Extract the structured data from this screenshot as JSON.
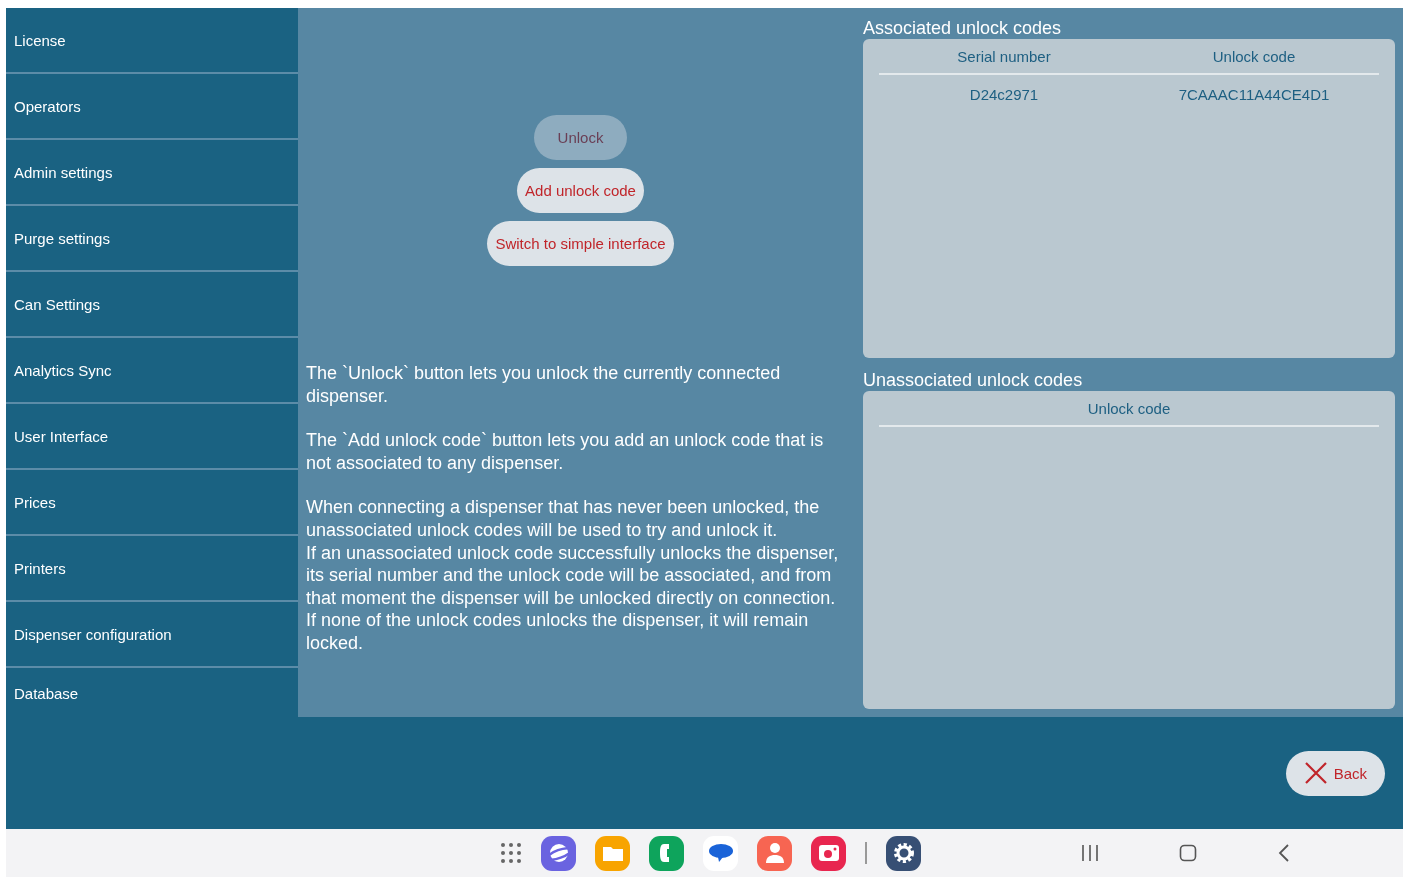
{
  "sidebar": {
    "items": [
      {
        "label": "License"
      },
      {
        "label": "Operators"
      },
      {
        "label": "Admin settings"
      },
      {
        "label": "Purge settings"
      },
      {
        "label": "Can Settings"
      },
      {
        "label": "Analytics Sync"
      },
      {
        "label": "User Interface"
      },
      {
        "label": "Prices"
      },
      {
        "label": "Printers"
      },
      {
        "label": "Dispenser configuration"
      },
      {
        "label": "Database"
      }
    ]
  },
  "actions": [
    {
      "label": "Unlock",
      "disabled": true
    },
    {
      "label": "Add unlock code",
      "disabled": false
    },
    {
      "label": "Switch to simple interface",
      "disabled": false
    }
  ],
  "description": [
    {
      "lines": [
        "The `Unlock` button lets you unlock the currently connected dispenser."
      ]
    },
    {
      "lines": [
        "The `Add unlock code` button lets you add an unlock code that is not associated to any dispenser."
      ]
    },
    {
      "lines": [
        "When connecting a dispenser that has never been unlocked, the unassociated unlock codes will be used to try and unlock it.",
        "If an unassociated unlock code successfully unlocks the dispenser, its serial number and the unlock code will be associated, and from that moment the dispenser will be unlocked directly on connection.",
        "If none of the unlock codes unlocks the dispenser, it will remain locked."
      ]
    }
  ],
  "associated": {
    "title": "Associated unlock codes",
    "columns": [
      "Serial number",
      "Unlock code"
    ],
    "rows": [
      [
        "D24c2971",
        "7CAAAC11A44CE4D1"
      ]
    ]
  },
  "unassociated": {
    "title": "Unassociated unlock codes",
    "columns": [
      "Unlock code"
    ]
  },
  "back_button": {
    "label": "Back"
  }
}
